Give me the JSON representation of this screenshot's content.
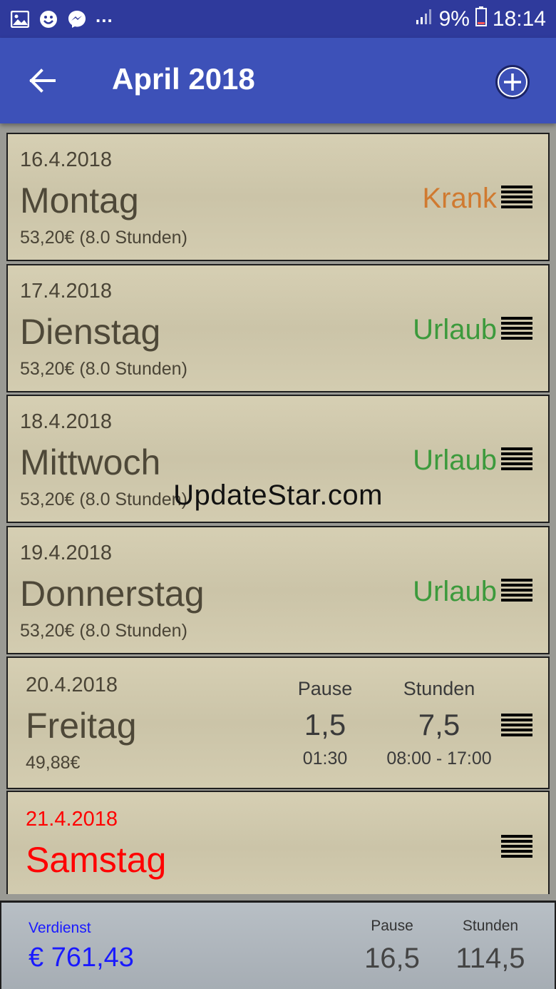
{
  "status_bar": {
    "icons_left": [
      "image-icon",
      "smiley-icon",
      "messenger-icon"
    ],
    "overflow": "...",
    "battery_percent": "9%",
    "time": "18:14"
  },
  "app_bar": {
    "title": "April 2018",
    "back_icon": "arrow-left-icon",
    "add_icon": "plus-circle-icon"
  },
  "days": [
    {
      "date": "16.4.2018",
      "day": "Montag",
      "earnings": "53,20€ (8.0 Stunden)",
      "status": "Krank",
      "status_color": "#d07a30"
    },
    {
      "date": "17.4.2018",
      "day": "Dienstag",
      "earnings": "53,20€ (8.0 Stunden)",
      "status": "Urlaub",
      "status_color": "#3c9a3c"
    },
    {
      "date": "18.4.2018",
      "day": "Mittwoch",
      "earnings": "53,20€ (8.0 Stunden)",
      "status": "Urlaub",
      "status_color": "#3c9a3c"
    },
    {
      "date": "19.4.2018",
      "day": "Donnerstag",
      "earnings": "53,20€ (8.0 Stunden)",
      "status": "Urlaub",
      "status_color": "#3c9a3c"
    },
    {
      "date": "20.4.2018",
      "day": "Freitag",
      "earnings": "49,88€",
      "pause_label": "Pause",
      "pause_value": "1,5",
      "pause_time": "01:30",
      "hours_label": "Stunden",
      "hours_value": "7,5",
      "hours_time": "08:00 - 17:00"
    },
    {
      "date": "21.4.2018",
      "day": "Samstag",
      "weekend_color": "#ff0000"
    }
  ],
  "watermark": "UpdateStar.com",
  "summary": {
    "earned_label": "Verdienst",
    "earned_value": "€ 761,43",
    "pause_label": "Pause",
    "pause_value": "16,5",
    "hours_label": "Stunden",
    "hours_value": "114,5",
    "accent_color": "#1a1aff"
  }
}
